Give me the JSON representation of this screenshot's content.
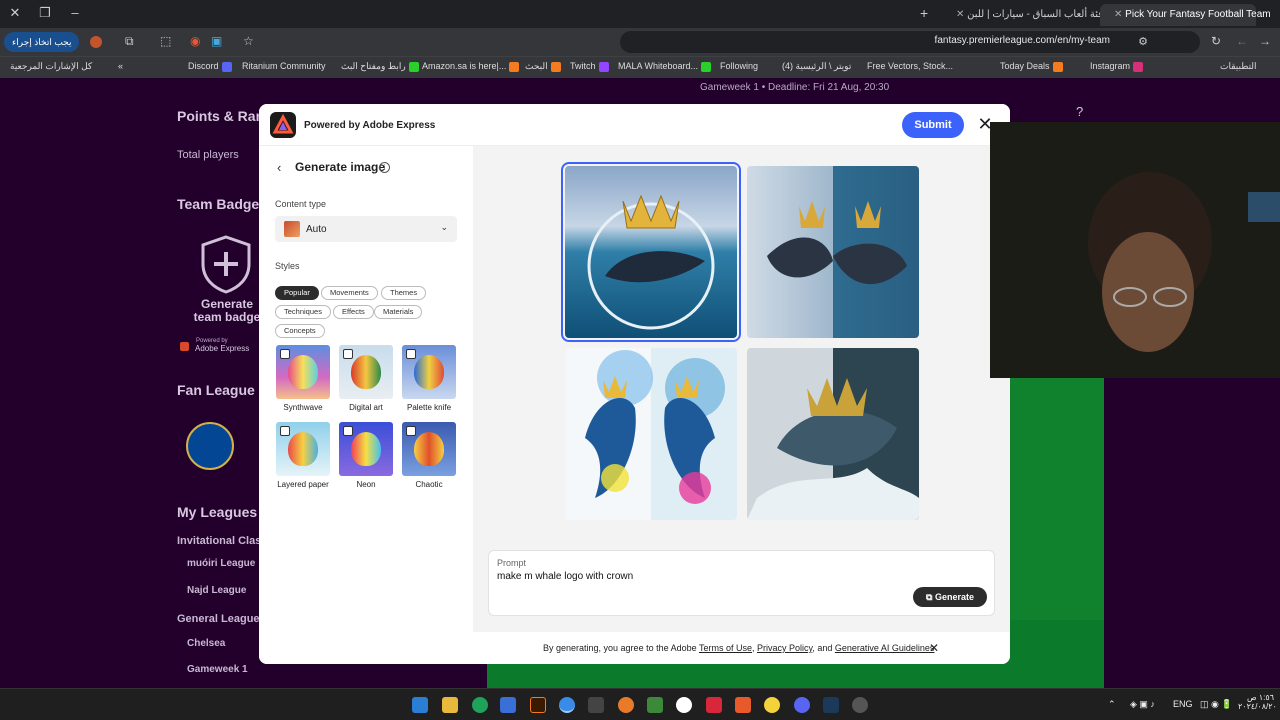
{
  "browser": {
    "tabs": [
      {
        "label": "Pick Your Fantasy Football Team",
        "active": true
      },
      {
        "label": "فئة ألعاب السباق - سيارات | للبن",
        "active": false
      }
    ],
    "url": "fantasy.premierleague.com/en/my-team",
    "action_button": "يجب اتخاذ إجراء",
    "bookmarks": [
      "Discord",
      "Ritanium Community",
      "رابط ومفتاح البث",
      "Amazon.sa is here|...",
      "البحث",
      "Twitch",
      "MALA Whiteboard...",
      "Following",
      "(4) تويتر \\ الرئيسية",
      "Free Vectors, Stock...",
      "Today Deals",
      "Instagram",
      "التطبيقات"
    ],
    "all_bookmarks": "كل الإشارات المرجعية"
  },
  "page": {
    "gameweek": "Gameweek 1",
    "deadline": "Deadline: Fri 21 Aug, 20:30",
    "help": "?",
    "sidebar": {
      "points_heading": "Points & Ran",
      "total_players": "Total players",
      "team_badge_heading": "Team Badge",
      "generate_badge": "Generate team badge",
      "powered_small": "Powered by",
      "adobe_express_small": "Adobe Express",
      "fan_league_heading": "Fan League",
      "my_leagues_heading": "My Leagues",
      "invitational": "Invitational Clas",
      "league_1": "muóiri League",
      "league_2": "Najd League",
      "general_leagues": "General League",
      "general_1": "Chelsea",
      "general_2": "Gameweek 1"
    }
  },
  "dialog": {
    "powered_by": "Powered by Adobe Express",
    "submit": "Submit",
    "panel_title": "Generate image",
    "content_type_label": "Content type",
    "content_type_value": "Auto",
    "styles_label": "Styles",
    "style_chips": [
      "Popular",
      "Movements",
      "Themes",
      "Techniques",
      "Effects",
      "Materials",
      "Concepts"
    ],
    "style_tiles": [
      "Synthwave",
      "Digital art",
      "Palette knife",
      "Layered paper",
      "Neon",
      "Chaotic"
    ],
    "prompt_label": "Prompt",
    "prompt_value": "make m whale logo with crown",
    "generate": "Generate",
    "terms_prefix": "By generating, you agree to the Adobe ",
    "terms_link1": "Terms of Use",
    "terms_sep1": ", ",
    "terms_link2": "Privacy Policy",
    "terms_sep2": ", and ",
    "terms_link3": "Generative AI Guidelines"
  },
  "taskbar": {
    "language": "ENG",
    "time": "١:٥٦ ص",
    "date": "٢٠٢٤/٠٨/٢٠"
  },
  "colors": {
    "accent": "#3b63fb",
    "page_bg": "#22002b",
    "pitch": "#10822e"
  }
}
